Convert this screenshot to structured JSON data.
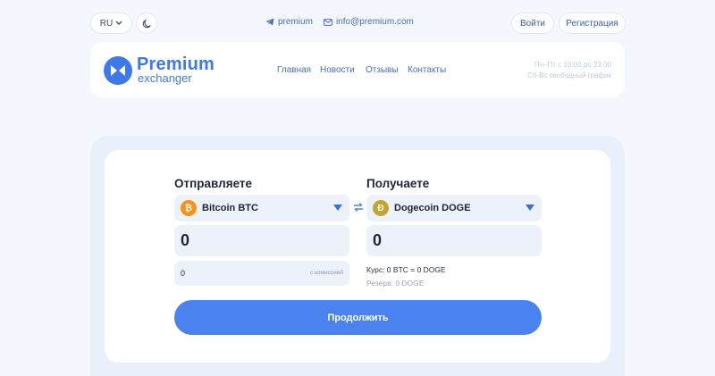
{
  "topbar": {
    "language": "RU",
    "telegram": "premium",
    "email": "info@premium.com",
    "login": "Войти",
    "register": "Регистрация"
  },
  "header": {
    "logo_title": "Premium",
    "logo_sub": "exchanger",
    "nav": [
      "Главная",
      "Новости",
      "Отзывы",
      "Контакты"
    ],
    "hours_line1": "Пн–Пт с 10:00 до 23:00",
    "hours_line2": "Сб-Вс свободный график"
  },
  "exchange": {
    "send_title": "Отправляете",
    "receive_title": "Получаете",
    "send_currency": "Bitcoin BTC",
    "receive_currency": "Dogecoin DOGE",
    "send_amount": "0",
    "receive_amount": "0",
    "commission_value": "0",
    "commission_label": "с комиссией",
    "rate": "Курс: 0 BTC = 0 DOGE",
    "reserve": "Резерв: 0 DOGE",
    "continue": "Продолжить"
  },
  "colors": {
    "accent": "#4a83ef",
    "bitcoin": "#f7931a",
    "dogecoin": "#c2a633"
  }
}
